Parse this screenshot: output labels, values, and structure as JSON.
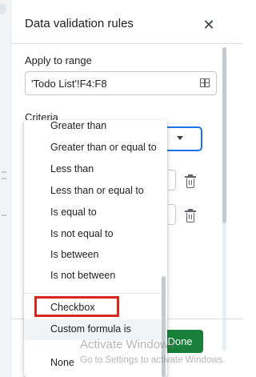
{
  "panel": {
    "title": "Data validation rules",
    "close_icon": "close-icon",
    "apply_to_range_label": "Apply to range",
    "range_value": "'Todo List'!F4:F8",
    "range_icon": "grid-select-icon",
    "criteria_label": "Criteria",
    "done_label": "Done"
  },
  "dropdown": {
    "options": [
      {
        "label": "Greater than"
      },
      {
        "label": "Greater than or equal to"
      },
      {
        "label": "Less than"
      },
      {
        "label": "Less than or equal to"
      },
      {
        "label": "Is equal to"
      },
      {
        "label": "Is not equal to"
      },
      {
        "label": "Is between"
      },
      {
        "label": "Is not between"
      },
      {
        "label": "Checkbox",
        "highlighted": true
      },
      {
        "label": "Custom formula is",
        "hovered": true
      },
      {
        "label": "None"
      }
    ]
  },
  "watermark": {
    "line1": "Activate Windows",
    "line2": "Go to Settings to activate Windows."
  },
  "colors": {
    "accent_blue": "#1a73e8",
    "done_green": "#188038",
    "highlight_red": "#d9251c"
  }
}
